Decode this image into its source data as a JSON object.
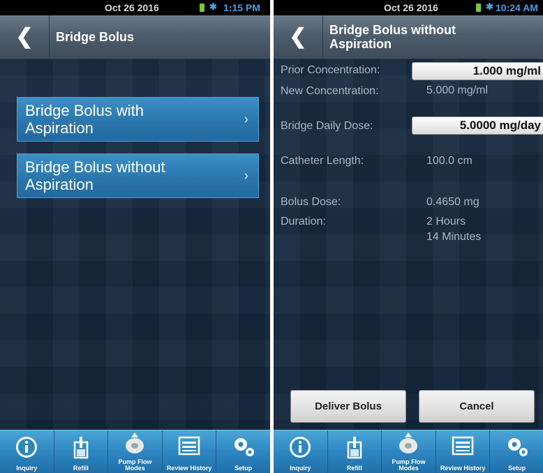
{
  "left": {
    "status": {
      "date": "Oct 26 2016",
      "time": "1:15 PM"
    },
    "title": "Bridge Bolus",
    "back_glyph": "❮",
    "menu": [
      {
        "label": "Bridge Bolus with Aspiration",
        "chevron": "›"
      },
      {
        "label": "Bridge Bolus without Aspiration",
        "chevron": "›"
      }
    ]
  },
  "right": {
    "status": {
      "date": "Oct 26 2016",
      "time": "10:24 AM"
    },
    "title": "Bridge Bolus without Aspiration",
    "back_glyph": "❮",
    "fields": {
      "prior_concentration": {
        "label": "Prior Concentration:",
        "value": "1.000 mg/ml"
      },
      "new_concentration": {
        "label": "New Concentration:",
        "value": "5.000 mg/ml"
      },
      "bridge_daily_dose": {
        "label": "Bridge Daily Dose:",
        "value": "5.0000 mg/day"
      },
      "catheter_length": {
        "label": "Catheter Length:",
        "value": "100.0 cm"
      },
      "bolus_dose": {
        "label": "Bolus Dose:",
        "value": "0.4650 mg"
      },
      "duration": {
        "label": "Duration:",
        "value_line1": "2 Hours",
        "value_line2": "14 Minutes"
      }
    },
    "buttons": {
      "deliver": "Deliver Bolus",
      "cancel": "Cancel"
    }
  },
  "nav": [
    {
      "label": "Inquiry",
      "icon": "info-icon"
    },
    {
      "label": "Refill",
      "icon": "refill-icon"
    },
    {
      "label_line1": "Pump Flow",
      "label_line2": "Modes",
      "icon": "pump-flow-icon"
    },
    {
      "label": "Review History",
      "icon": "review-history-icon"
    },
    {
      "label": "Setup",
      "icon": "setup-gears-icon"
    }
  ],
  "colors": {
    "accent_blue": "#2e86c1",
    "menu_blue": "#2a77ad",
    "background": "#17293e",
    "status_time": "#4a9ee0",
    "battery": "#7bc242"
  }
}
